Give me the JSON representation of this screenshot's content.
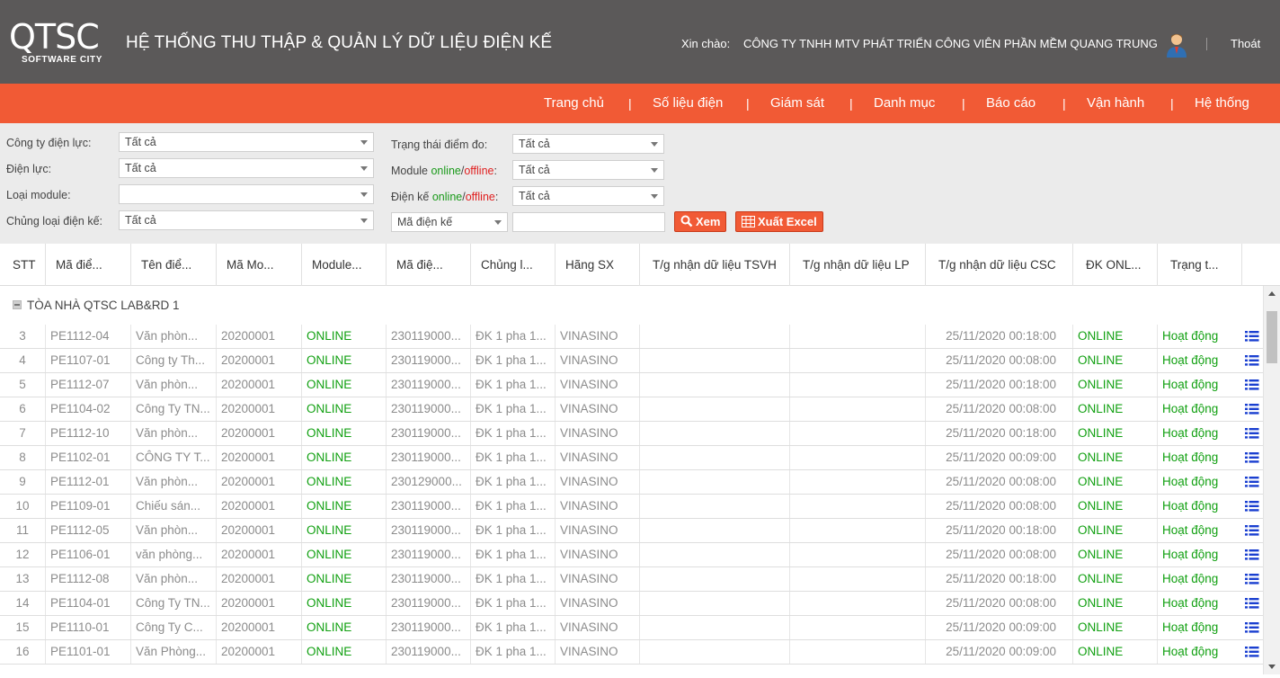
{
  "header": {
    "logo_text": "QTSC",
    "logo_sub": "SOFTWARE CITY",
    "system_title": "HỆ THỐNG THU THẬP & QUẢN LÝ DỮ LIỆU ĐIỆN KẾ",
    "greeting_label": "Xin chào:",
    "company_name": "CÔNG TY TNHH MTV PHÁT TRIỂN CÔNG VIÊN PHẦN MỀM QUANG TRUNG",
    "logout_label": "Thoát"
  },
  "nav": {
    "items": [
      "Trang chủ",
      "Số liệu điện",
      "Giám sát",
      "Danh mục",
      "Báo cáo",
      "Vận hành",
      "Hệ thống"
    ],
    "separator": "|"
  },
  "filters": {
    "power_company": {
      "label": "Công ty điện lực:",
      "value": "Tất cả"
    },
    "power_unit": {
      "label": "Điện lực:",
      "value": "Tất cả"
    },
    "module_type": {
      "label": "Loại module:",
      "value": ""
    },
    "meter_type": {
      "label": "Chủng loại điện kế:",
      "value": "Tất cả"
    },
    "point_status": {
      "label": "Trạng thái điểm đo:",
      "value": "Tất cả"
    },
    "module_online": {
      "label_prefix": "Module ",
      "online": "online",
      "slash": "/",
      "offline": "offline",
      "colon": ":",
      "value": "Tất cả"
    },
    "meter_online": {
      "label_prefix": "Điện kế ",
      "online": "online",
      "slash": "/",
      "offline": "offline",
      "colon": ":",
      "value": "Tất cả"
    },
    "search_field": {
      "value": "Mã điện kế"
    },
    "search_input": {
      "value": ""
    },
    "view_button": "Xem",
    "export_button": "Xuất Excel"
  },
  "table": {
    "columns": [
      "STT",
      "Mã điể...",
      "Tên điể...",
      "Mã Mo...",
      "Module...",
      "Mã điệ...",
      "Chủng l...",
      "Hãng SX",
      "T/g nhận dữ liệu TSVH",
      "T/g nhận dữ liệu LP",
      "T/g nhận dữ liệu CSC",
      "ĐK ONL...",
      "Trạng t..."
    ],
    "group": "TÒA NHÀ QTSC LAB&RD 1",
    "rows": [
      {
        "stt": "3",
        "ma_diem": "PE1112-04",
        "ten_diem": "Văn phòn...",
        "ma_module": "20200001",
        "module": "ONLINE",
        "ma_dk": "230119000...",
        "chung_loai": "ĐK 1 pha 1...",
        "hang": "VINASINO",
        "tsvh": "",
        "lp": "",
        "csc": "25/11/2020 00:18:00",
        "dk_online": "ONLINE",
        "trang_thai": "Hoạt động"
      },
      {
        "stt": "4",
        "ma_diem": "PE1107-01",
        "ten_diem": "Công ty Th...",
        "ma_module": "20200001",
        "module": "ONLINE",
        "ma_dk": "230119000...",
        "chung_loai": "ĐK 1 pha 1...",
        "hang": "VINASINO",
        "tsvh": "",
        "lp": "",
        "csc": "25/11/2020 00:08:00",
        "dk_online": "ONLINE",
        "trang_thai": "Hoạt động"
      },
      {
        "stt": "5",
        "ma_diem": "PE1112-07",
        "ten_diem": "Văn phòn...",
        "ma_module": "20200001",
        "module": "ONLINE",
        "ma_dk": "230119000...",
        "chung_loai": "ĐK 1 pha 1...",
        "hang": "VINASINO",
        "tsvh": "",
        "lp": "",
        "csc": "25/11/2020 00:18:00",
        "dk_online": "ONLINE",
        "trang_thai": "Hoạt động"
      },
      {
        "stt": "6",
        "ma_diem": "PE1104-02",
        "ten_diem": "Công Ty TN...",
        "ma_module": "20200001",
        "module": "ONLINE",
        "ma_dk": "230119000...",
        "chung_loai": "ĐK 1 pha 1...",
        "hang": "VINASINO",
        "tsvh": "",
        "lp": "",
        "csc": "25/11/2020 00:08:00",
        "dk_online": "ONLINE",
        "trang_thai": "Hoạt động"
      },
      {
        "stt": "7",
        "ma_diem": "PE1112-10",
        "ten_diem": "Văn phòn...",
        "ma_module": "20200001",
        "module": "ONLINE",
        "ma_dk": "230119000...",
        "chung_loai": "ĐK 1 pha 1...",
        "hang": "VINASINO",
        "tsvh": "",
        "lp": "",
        "csc": "25/11/2020 00:18:00",
        "dk_online": "ONLINE",
        "trang_thai": "Hoạt động"
      },
      {
        "stt": "8",
        "ma_diem": "PE1102-01",
        "ten_diem": "CÔNG TY T...",
        "ma_module": "20200001",
        "module": "ONLINE",
        "ma_dk": "230119000...",
        "chung_loai": "ĐK 1 pha 1...",
        "hang": "VINASINO",
        "tsvh": "",
        "lp": "",
        "csc": "25/11/2020 00:09:00",
        "dk_online": "ONLINE",
        "trang_thai": "Hoạt động"
      },
      {
        "stt": "9",
        "ma_diem": "PE1112-01",
        "ten_diem": "Văn phòn...",
        "ma_module": "20200001",
        "module": "ONLINE",
        "ma_dk": "230129000...",
        "chung_loai": "ĐK 1 pha 1...",
        "hang": "VINASINO",
        "tsvh": "",
        "lp": "",
        "csc": "25/11/2020 00:08:00",
        "dk_online": "ONLINE",
        "trang_thai": "Hoạt động"
      },
      {
        "stt": "10",
        "ma_diem": "PE1109-01",
        "ten_diem": "Chiếu sán...",
        "ma_module": "20200001",
        "module": "ONLINE",
        "ma_dk": "230119000...",
        "chung_loai": "ĐK 1 pha 1...",
        "hang": "VINASINO",
        "tsvh": "",
        "lp": "",
        "csc": "25/11/2020 00:08:00",
        "dk_online": "ONLINE",
        "trang_thai": "Hoạt động"
      },
      {
        "stt": "11",
        "ma_diem": "PE1112-05",
        "ten_diem": "Văn phòn...",
        "ma_module": "20200001",
        "module": "ONLINE",
        "ma_dk": "230119000...",
        "chung_loai": "ĐK 1 pha 1...",
        "hang": "VINASINO",
        "tsvh": "",
        "lp": "",
        "csc": "25/11/2020 00:18:00",
        "dk_online": "ONLINE",
        "trang_thai": "Hoạt động"
      },
      {
        "stt": "12",
        "ma_diem": "PE1106-01",
        "ten_diem": "văn phòng...",
        "ma_module": "20200001",
        "module": "ONLINE",
        "ma_dk": "230119000...",
        "chung_loai": "ĐK 1 pha 1...",
        "hang": "VINASINO",
        "tsvh": "",
        "lp": "",
        "csc": "25/11/2020 00:08:00",
        "dk_online": "ONLINE",
        "trang_thai": "Hoạt động"
      },
      {
        "stt": "13",
        "ma_diem": "PE1112-08",
        "ten_diem": "Văn phòn...",
        "ma_module": "20200001",
        "module": "ONLINE",
        "ma_dk": "230119000...",
        "chung_loai": "ĐK 1 pha 1...",
        "hang": "VINASINO",
        "tsvh": "",
        "lp": "",
        "csc": "25/11/2020 00:18:00",
        "dk_online": "ONLINE",
        "trang_thai": "Hoạt động"
      },
      {
        "stt": "14",
        "ma_diem": "PE1104-01",
        "ten_diem": "Công Ty TN...",
        "ma_module": "20200001",
        "module": "ONLINE",
        "ma_dk": "230119000...",
        "chung_loai": "ĐK 1 pha 1...",
        "hang": "VINASINO",
        "tsvh": "",
        "lp": "",
        "csc": "25/11/2020 00:08:00",
        "dk_online": "ONLINE",
        "trang_thai": "Hoạt động"
      },
      {
        "stt": "15",
        "ma_diem": "PE1110-01",
        "ten_diem": "Công Ty C...",
        "ma_module": "20200001",
        "module": "ONLINE",
        "ma_dk": "230119000...",
        "chung_loai": "ĐK 1 pha 1...",
        "hang": "VINASINO",
        "tsvh": "",
        "lp": "",
        "csc": "25/11/2020 00:09:00",
        "dk_online": "ONLINE",
        "trang_thai": "Hoạt động"
      },
      {
        "stt": "16",
        "ma_diem": "PE1101-01",
        "ten_diem": "Văn Phòng...",
        "ma_module": "20200001",
        "module": "ONLINE",
        "ma_dk": "230119000...",
        "chung_loai": "ĐK 1 pha 1...",
        "hang": "VINASINO",
        "tsvh": "",
        "lp": "",
        "csc": "25/11/2020 00:09:00",
        "dk_online": "ONLINE",
        "trang_thai": "Hoạt động"
      }
    ]
  },
  "colors": {
    "header_bg": "#5b5959",
    "nav_bg": "#f15a35",
    "online_green": "#11a011",
    "offline_red": "#e02020",
    "icon_blue": "#1a3fd0"
  },
  "icons": {
    "view": "search-icon",
    "export": "table-grid-icon",
    "row_detail": "list-icon",
    "user": "user-avatar-icon"
  }
}
